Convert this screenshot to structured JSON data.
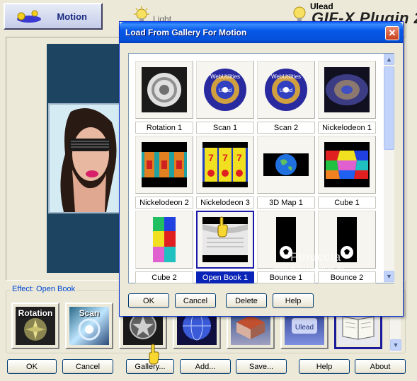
{
  "main": {
    "tab_motion": "Motion",
    "tab_other_partial": "Light",
    "brand_small": "Ulead",
    "brand_title": "GIF-X Plugin 2.0",
    "effect_label": "Effect: Open Book",
    "strip_thumbs": [
      {
        "title": "Rotation",
        "icon": "rotation-thumb"
      },
      {
        "title": "Scan",
        "icon": "scan-thumb"
      },
      {
        "title": "",
        "icon": "nickelodeon-thumb"
      },
      {
        "title": "",
        "icon": "3d-map-thumb"
      },
      {
        "title": "",
        "icon": "cube-thumb"
      },
      {
        "title": "",
        "icon": "ulead-thumb"
      },
      {
        "title": "",
        "icon": "open-book-thumb"
      }
    ],
    "buttons": {
      "ok": "OK",
      "cancel": "Cancel",
      "gallery": "Gallery...",
      "add": "Add...",
      "save": "Save...",
      "help": "Help",
      "about": "About"
    }
  },
  "dialog": {
    "title": "Load From Gallery For Motion",
    "close_icon": "close-icon",
    "items": [
      {
        "label": "Rotation 1"
      },
      {
        "label": "Scan 1"
      },
      {
        "label": "Scan 2"
      },
      {
        "label": "Nickelodeon 1"
      },
      {
        "label": "Nickelodeon 2"
      },
      {
        "label": "Nickelodeon 3"
      },
      {
        "label": "3D Map 1"
      },
      {
        "label": "Cube 1"
      },
      {
        "label": "Cube 2"
      },
      {
        "label": "Open Book 1"
      },
      {
        "label": "Bounce 1"
      },
      {
        "label": "Bounce 2"
      }
    ],
    "selected_label": "Open Book 1",
    "watermark_top": "Pinuccia",
    "watermark_bottom": "www.maidiregrafica.eu",
    "buttons": {
      "ok": "OK",
      "cancel": "Cancel",
      "delete": "Delete",
      "help": "Help"
    }
  },
  "colors": {
    "accent_blue": "#0a24b8",
    "preview_bg": "#1d4562",
    "titlebar": "#0758e8"
  }
}
